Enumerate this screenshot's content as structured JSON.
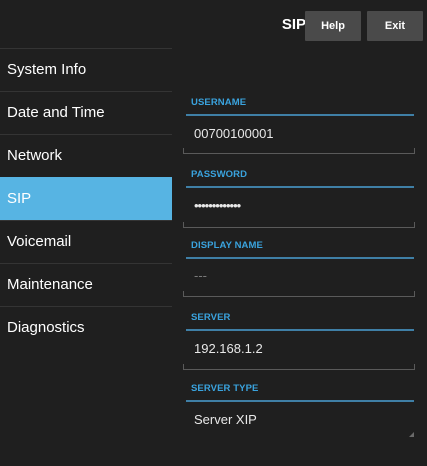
{
  "header": {
    "title": "SIP",
    "help_label": "Help",
    "exit_label": "Exit"
  },
  "sidebar": {
    "items": [
      {
        "label": "System Info"
      },
      {
        "label": "Date and Time"
      },
      {
        "label": "Network"
      },
      {
        "label": "SIP",
        "active": true
      },
      {
        "label": "Voicemail"
      },
      {
        "label": "Maintenance"
      },
      {
        "label": "Diagnostics"
      }
    ]
  },
  "form": {
    "username": {
      "label": "USERNAME",
      "value": "00700100001"
    },
    "password": {
      "label": "PASSWORD",
      "value": "•••••••••••••"
    },
    "display_name": {
      "label": "DISPLAY NAME",
      "placeholder": "---"
    },
    "server": {
      "label": "SERVER",
      "value": "192.168.1.2"
    },
    "server_type": {
      "label": "SERVER TYPE",
      "value": "Server XIP"
    }
  },
  "colors": {
    "accent": "#57b4e3",
    "label_blue": "#3aa3de",
    "background": "#1f1f1f",
    "button": "#4a4a4a"
  }
}
